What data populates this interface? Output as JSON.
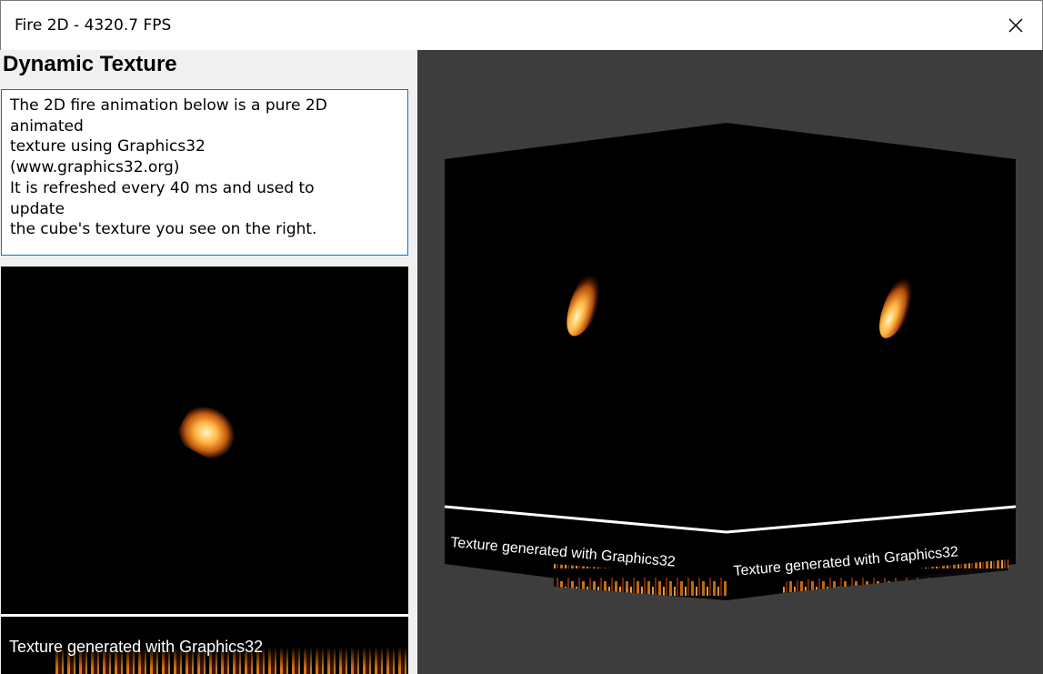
{
  "window": {
    "title": "Fire 2D - 4320.7 FPS",
    "close_icon": "close-icon"
  },
  "left_panel": {
    "heading": "Dynamic Texture",
    "description": "The 2D fire animation below is a pure 2D animated\ntexture using Graphics32 (www.graphics32.org)\nIt is refreshed every 40 ms and used to update\nthe cube's texture you see on the right.",
    "texture_caption": "Texture generated with Graphics32"
  },
  "viewport": {
    "background": "#3d3d3d",
    "cube_face_left_caption": "Texture generated with Graphics32",
    "cube_face_right_caption": "Texture generated with Graphics32"
  },
  "colors": {
    "accent": "#0078d7",
    "fire": "#ffb340"
  }
}
